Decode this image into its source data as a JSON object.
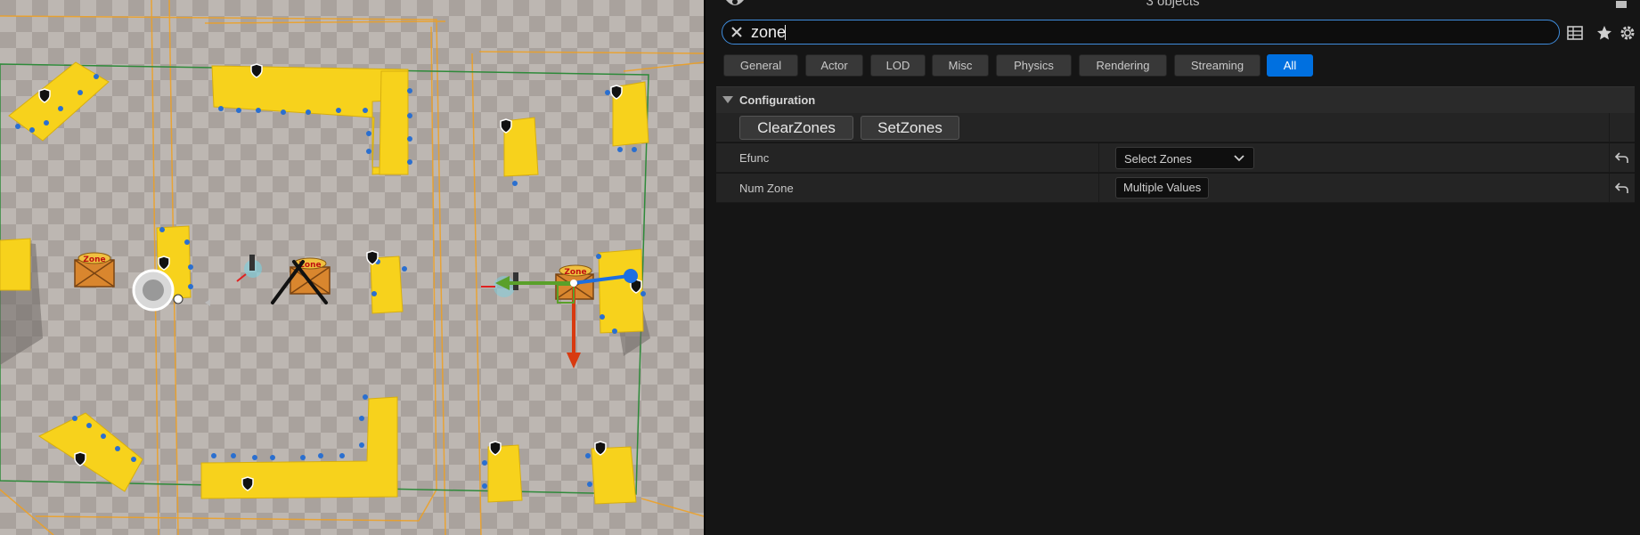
{
  "header": {
    "object_count": "3 objects"
  },
  "search": {
    "value": "zone",
    "placeholder": ""
  },
  "filters": [
    {
      "label": "General",
      "active": false
    },
    {
      "label": "Actor",
      "active": false
    },
    {
      "label": "LOD",
      "active": false
    },
    {
      "label": "Misc",
      "active": false
    },
    {
      "label": "Physics",
      "active": false
    },
    {
      "label": "Rendering",
      "active": false
    },
    {
      "label": "Streaming",
      "active": false
    },
    {
      "label": "All",
      "active": true
    }
  ],
  "section": {
    "title": "Configuration",
    "buttons": {
      "clear": "ClearZones",
      "set": "SetZones"
    },
    "properties": {
      "efunc": {
        "label": "Efunc",
        "value": "Select Zones"
      },
      "num_zone": {
        "label": "Num Zone",
        "value": "Multiple Values"
      }
    }
  },
  "viewport": {
    "zone_labels": [
      "Zone",
      "Zone",
      "Zone"
    ]
  },
  "colors": {
    "accent": "#0070e0",
    "search_border": "#3f8cdc",
    "panel_bg": "#151515",
    "block_yellow": "#f7d21c"
  },
  "icons": [
    "eye-icon",
    "lock-icon",
    "close-icon",
    "table-view-icon",
    "star-icon",
    "gear-icon",
    "chevron-down-icon",
    "reset-arrow-icon"
  ]
}
